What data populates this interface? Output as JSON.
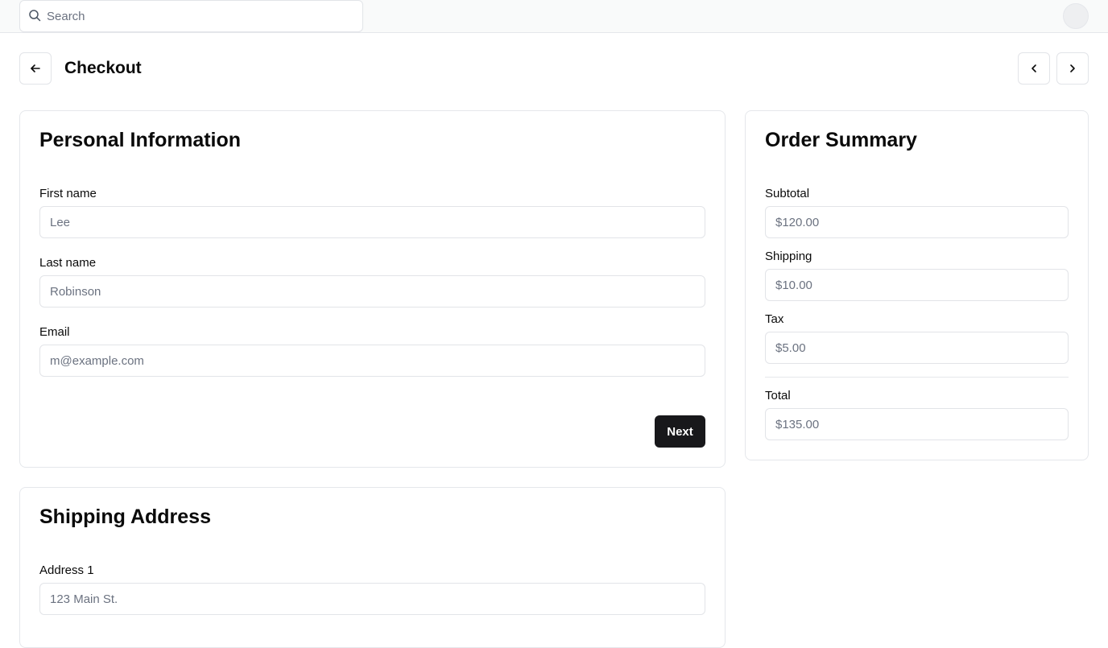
{
  "topbar": {
    "search_placeholder": "Search",
    "search_icon": "search-icon",
    "avatar_icon": "user-avatar"
  },
  "header": {
    "title": "Checkout",
    "back_icon": "arrow-left-icon",
    "prev_icon": "chevron-left-icon",
    "next_icon": "chevron-right-icon"
  },
  "personal": {
    "title": "Personal Information",
    "first_name_label": "First name",
    "first_name_placeholder": "Lee",
    "last_name_label": "Last name",
    "last_name_placeholder": "Robinson",
    "email_label": "Email",
    "email_placeholder": "m@example.com",
    "next_label": "Next"
  },
  "summary": {
    "title": "Order Summary",
    "subtotal_label": "Subtotal",
    "subtotal_value": "$120.00",
    "shipping_label": "Shipping",
    "shipping_value": "$10.00",
    "tax_label": "Tax",
    "tax_value": "$5.00",
    "total_label": "Total",
    "total_value": "$135.00"
  },
  "shipping": {
    "title": "Shipping Address",
    "address1_label": "Address 1",
    "address1_placeholder": "123 Main St."
  },
  "colors": {
    "primary_button": "#18181b",
    "border": "#e5e7eb",
    "topbar_bg": "#f9fafa",
    "muted_text": "#6b7280"
  }
}
